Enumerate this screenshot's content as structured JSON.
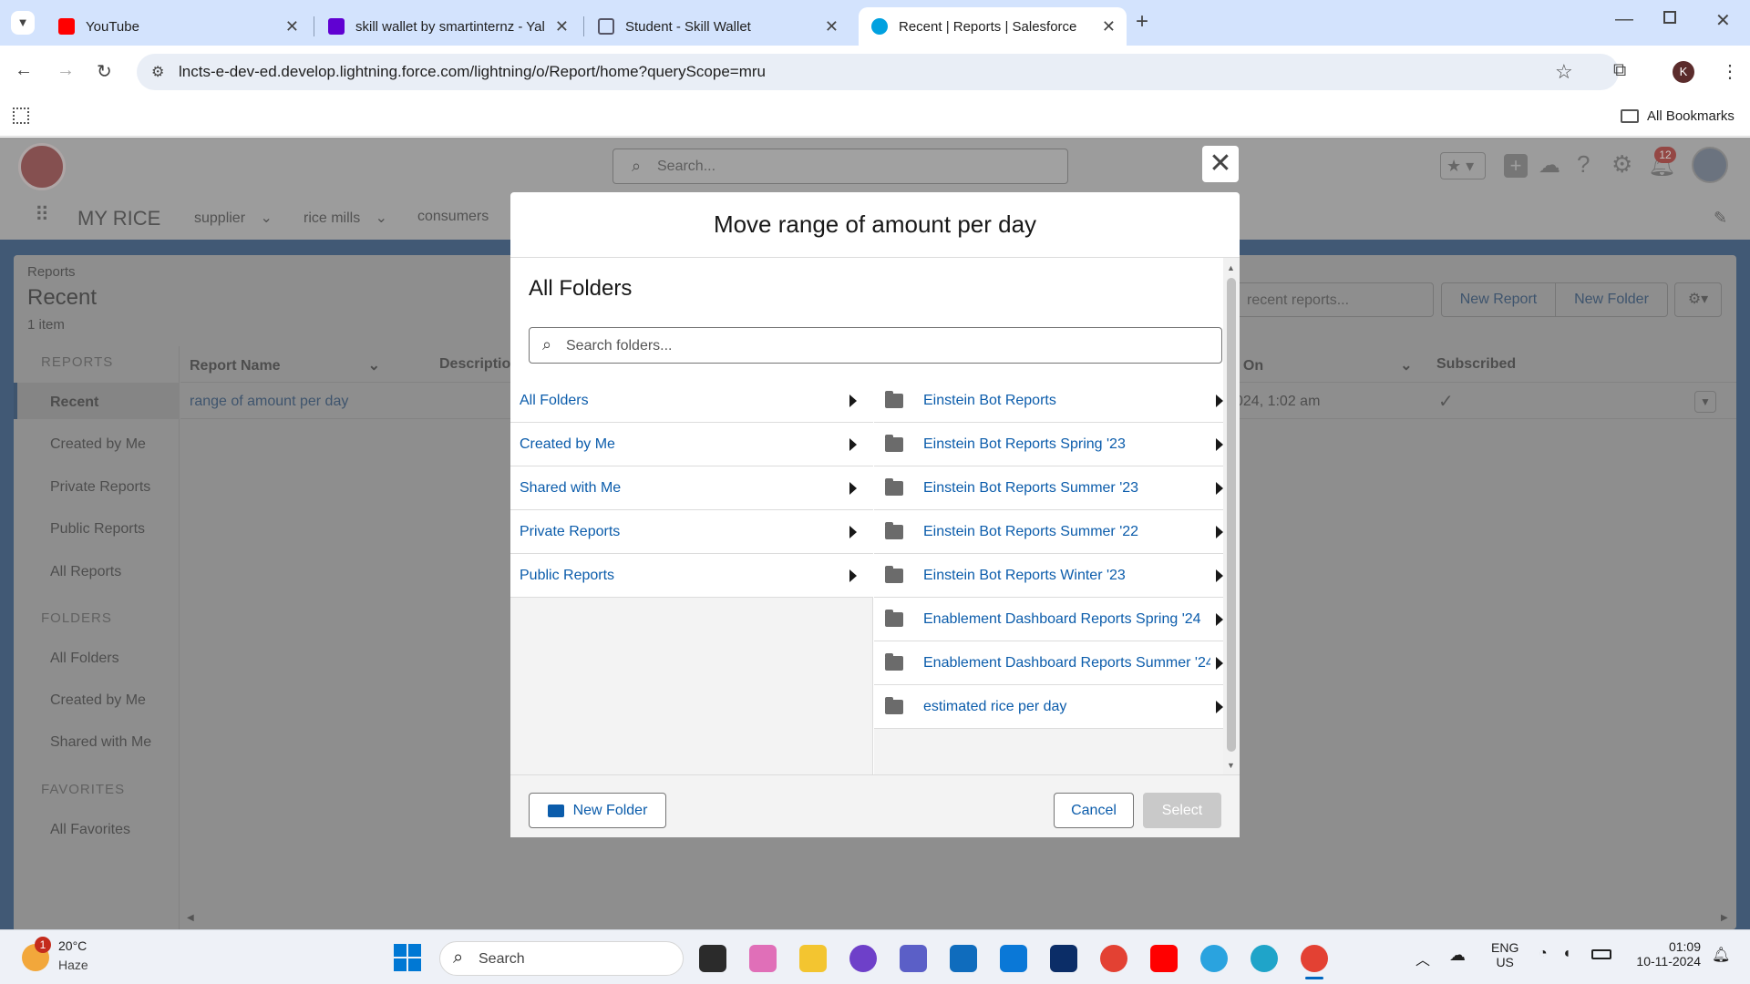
{
  "browser": {
    "tabs": [
      {
        "title": "YouTube"
      },
      {
        "title": "skill wallet by smartinternz - Yal"
      },
      {
        "title": "Student - Skill Wallet"
      },
      {
        "title": "Recent | Reports | Salesforce"
      }
    ],
    "url": "lncts-e-dev-ed.develop.lightning.force.com/lightning/o/Report/home?queryScope=mru",
    "bookmarks_label": "All Bookmarks",
    "profile_initial": "K"
  },
  "sf": {
    "search_placeholder": "Search...",
    "notification_count": "12",
    "app_name": "MY RICE",
    "nav": [
      "supplier",
      "rice mills",
      "consumers"
    ],
    "breadcrumb": "Reports",
    "page_title": "Recent",
    "item_count": "1 item",
    "search_reports_placeholder": "recent reports...",
    "new_report_label": "New Report",
    "new_folder_label": "New Folder",
    "sidebar": {
      "reports_header": "REPORTS",
      "reports_items": [
        "Recent",
        "Created by Me",
        "Private Reports",
        "Public Reports",
        "All Reports"
      ],
      "folders_header": "FOLDERS",
      "folders_items": [
        "All Folders",
        "Created by Me",
        "Shared with Me"
      ],
      "favorites_header": "FAVORITES",
      "favorites_items": [
        "All Favorites"
      ]
    },
    "table": {
      "col_report_name": "Report Name",
      "col_description": "Descriptio",
      "col_modified_on": "l On",
      "col_subscribed": "Subscribed",
      "row_name": "range of amount per day",
      "row_date": "024, 1:02 am"
    }
  },
  "modal": {
    "title": "Move range of amount per day",
    "section_title": "All Folders",
    "search_placeholder": "Search folders...",
    "left_items": [
      "All Folders",
      "Created by Me",
      "Shared with Me",
      "Private Reports",
      "Public Reports"
    ],
    "right_items": [
      "Einstein Bot Reports",
      "Einstein Bot Reports Spring '23",
      "Einstein Bot Reports Summer '23",
      "Einstein Bot Reports Summer '22",
      "Einstein Bot Reports Winter '23",
      "Enablement Dashboard Reports Spring '24",
      "Enablement Dashboard Reports Summer '24",
      "estimated rice per day"
    ],
    "new_folder_label": "New Folder",
    "cancel_label": "Cancel",
    "select_label": "Select"
  },
  "taskbar": {
    "weather_temp": "20°C",
    "weather_desc": "Haze",
    "weather_badge": "1",
    "search_label": "Search",
    "lang": "ENG",
    "region": "US",
    "time": "01:09",
    "date": "10-11-2024"
  }
}
